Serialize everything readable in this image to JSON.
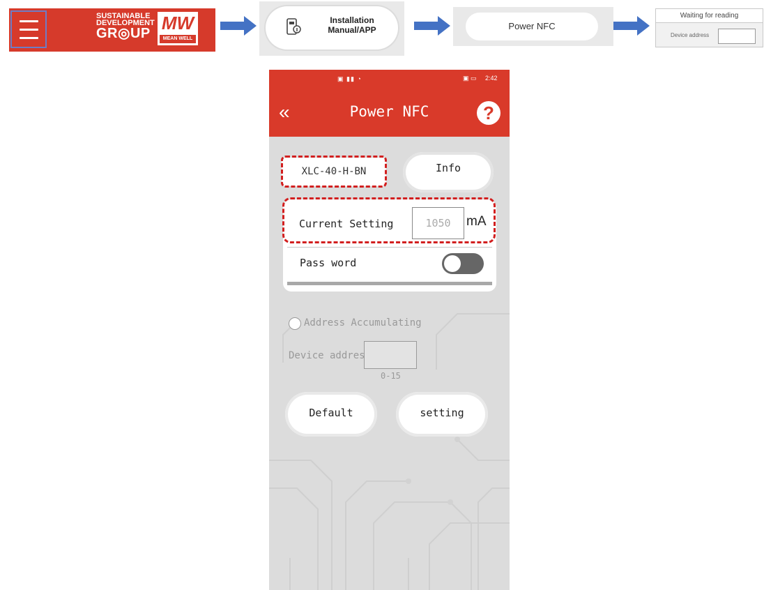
{
  "flow": {
    "banner": {
      "line1": "SUSTAINABLE",
      "line2": "DEVELOPMENT",
      "line3": "GR◎UP",
      "logo_mark": "MW",
      "logo_name": "MEAN WELL"
    },
    "step1": {
      "line1": "Installation",
      "line2": "Manual/APP",
      "icon": "phone-manual-icon"
    },
    "step2": {
      "label": "Power NFC"
    },
    "step3": {
      "title": "Waiting for reading",
      "device_label": "Device address",
      "device_value": ""
    },
    "arrow_color": "#4472c4"
  },
  "phone": {
    "status_time": "2:42",
    "title": "Power NFC",
    "back_icon": "double-chevron-left-icon",
    "help_icon": "question-icon",
    "model": "XLC-40-H-BN",
    "info_label": "Info",
    "current_label": "Current Setting",
    "current_value": "1050",
    "current_unit": "mA",
    "password_label": "Pass word",
    "password_enabled": false,
    "address_accumulating_label": "Address Accumulating",
    "device_address_label": "Device address",
    "device_address_value": "",
    "device_address_range": "0-15",
    "default_label": "Default",
    "setting_label": "setting",
    "accent_color": "#d93a2a",
    "highlight_color": "#d21f1f"
  }
}
